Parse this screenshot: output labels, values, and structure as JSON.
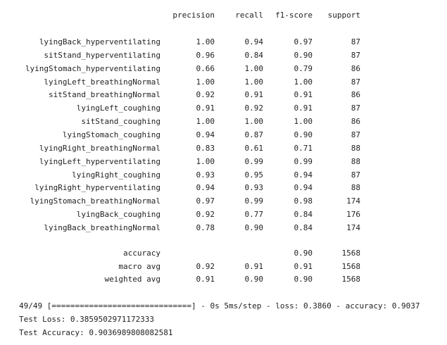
{
  "report": {
    "headers": [
      "precision",
      "recall",
      "f1-score",
      "support"
    ],
    "rows": [
      {
        "label": "lyingBack_hyperventilating",
        "precision": "1.00",
        "recall": "0.94",
        "f1": "0.97",
        "support": "87"
      },
      {
        "label": "sitStand_hyperventilating",
        "precision": "0.96",
        "recall": "0.84",
        "f1": "0.90",
        "support": "87"
      },
      {
        "label": "lyingStomach_hyperventilating",
        "precision": "0.66",
        "recall": "1.00",
        "f1": "0.79",
        "support": "86"
      },
      {
        "label": "lyingLeft_breathingNormal",
        "precision": "1.00",
        "recall": "1.00",
        "f1": "1.00",
        "support": "87"
      },
      {
        "label": "sitStand_breathingNormal",
        "precision": "0.92",
        "recall": "0.91",
        "f1": "0.91",
        "support": "86"
      },
      {
        "label": "lyingLeft_coughing",
        "precision": "0.91",
        "recall": "0.92",
        "f1": "0.91",
        "support": "87"
      },
      {
        "label": "sitStand_coughing",
        "precision": "1.00",
        "recall": "1.00",
        "f1": "1.00",
        "support": "86"
      },
      {
        "label": "lyingStomach_coughing",
        "precision": "0.94",
        "recall": "0.87",
        "f1": "0.90",
        "support": "87"
      },
      {
        "label": "lyingRight_breathingNormal",
        "precision": "0.83",
        "recall": "0.61",
        "f1": "0.71",
        "support": "88"
      },
      {
        "label": "lyingLeft_hyperventilating",
        "precision": "1.00",
        "recall": "0.99",
        "f1": "0.99",
        "support": "88"
      },
      {
        "label": "lyingRight_coughing",
        "precision": "0.93",
        "recall": "0.95",
        "f1": "0.94",
        "support": "87"
      },
      {
        "label": "lyingRight_hyperventilating",
        "precision": "0.94",
        "recall": "0.93",
        "f1": "0.94",
        "support": "88"
      },
      {
        "label": "lyingStomach_breathingNormal",
        "precision": "0.97",
        "recall": "0.99",
        "f1": "0.98",
        "support": "174"
      },
      {
        "label": "lyingBack_coughing",
        "precision": "0.92",
        "recall": "0.77",
        "f1": "0.84",
        "support": "176"
      },
      {
        "label": "lyingBack_breathingNormal",
        "precision": "0.78",
        "recall": "0.90",
        "f1": "0.84",
        "support": "174"
      }
    ],
    "summary": [
      {
        "label": "accuracy",
        "precision": "",
        "recall": "",
        "f1": "0.90",
        "support": "1568"
      },
      {
        "label": "macro avg",
        "precision": "0.92",
        "recall": "0.91",
        "f1": "0.91",
        "support": "1568"
      },
      {
        "label": "weighted avg",
        "precision": "0.91",
        "recall": "0.90",
        "f1": "0.90",
        "support": "1568"
      }
    ]
  },
  "log": {
    "progress_line": "49/49 [==============================] - 0s 5ms/step - loss: 0.3860 - accuracy: 0.9037",
    "test_loss_line": "Test Loss: 0.3859502971172333",
    "test_accuracy_line": "Test Accuracy: 0.9036989808082581"
  }
}
